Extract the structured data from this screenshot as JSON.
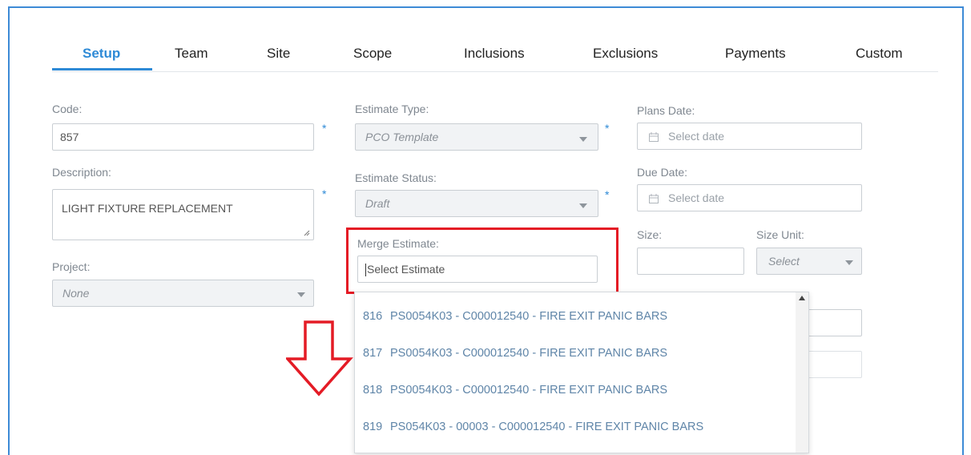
{
  "tabs": [
    {
      "label": "Setup",
      "active": true
    },
    {
      "label": "Team"
    },
    {
      "label": "Site"
    },
    {
      "label": "Scope"
    },
    {
      "label": "Inclusions"
    },
    {
      "label": "Exclusions"
    },
    {
      "label": "Payments"
    },
    {
      "label": "Custom"
    }
  ],
  "form": {
    "code": {
      "label": "Code:",
      "value": "857",
      "required": "*"
    },
    "description": {
      "label": "Description:",
      "value": "LIGHT FIXTURE REPLACEMENT",
      "required": "*"
    },
    "project": {
      "label": "Project:",
      "value": "None"
    },
    "estimate_type": {
      "label": "Estimate Type:",
      "value": "PCO Template",
      "required": "*"
    },
    "estimate_status": {
      "label": "Estimate Status:",
      "value": "Draft",
      "required": "*"
    },
    "merge_estimate": {
      "label": "Merge Estimate:",
      "placeholder": "Select Estimate"
    },
    "plans_date": {
      "label": "Plans Date:",
      "placeholder": "Select date"
    },
    "due_date": {
      "label": "Due Date:",
      "placeholder": "Select date"
    },
    "size": {
      "label": "Size:",
      "value": ""
    },
    "size_unit": {
      "label": "Size Unit:",
      "value": "Select"
    }
  },
  "merge_dropdown": {
    "items": [
      {
        "code": "816",
        "text": "PS0054K03 - C000012540 - FIRE EXIT PANIC BARS"
      },
      {
        "code": "817",
        "text": "PS0054K03 - C000012540 - FIRE EXIT PANIC BARS"
      },
      {
        "code": "818",
        "text": "PS0054K03 - C000012540 - FIRE EXIT PANIC BARS"
      },
      {
        "code": "819",
        "text": "PS054K03 - 00003 - C000012540 - FIRE EXIT PANIC BARS"
      }
    ]
  },
  "colors": {
    "accent": "#2e8ad6",
    "highlight": "#e41b25",
    "frame": "#3d8ad6"
  }
}
